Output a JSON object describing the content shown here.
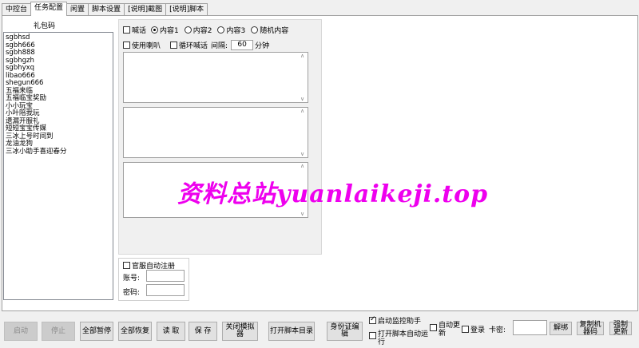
{
  "tabs": [
    {
      "label": "中控台"
    },
    {
      "label": "任务配置"
    },
    {
      "label": "闲置"
    },
    {
      "label": "脚本设置"
    },
    {
      "label": "[说明]截图"
    },
    {
      "label": "[说明]脚本"
    }
  ],
  "gift": {
    "title": "礼包码",
    "codes": [
      "sgbhsd",
      "sgbh666",
      "sgbh888",
      "sgbhgzh",
      "sgbhyxq",
      "libao666",
      "shegun666",
      "五福来临",
      "五福临宝奖励",
      "小小玩宝",
      "小叶陪我玩",
      "遗漏开服礼",
      "短短宝宝传媒",
      "三冰上号时间到",
      "龙油龙狗",
      "三冰小助手喜迎春分"
    ]
  },
  "shout": {
    "checkbox_label": "喊话",
    "radios": [
      "内容1",
      "内容2",
      "内容3",
      "随机内容"
    ],
    "selected": "内容1",
    "speaker_label": "使用喇叭",
    "loop_label": "循环喊话",
    "interval_label": "间隔:",
    "interval_value": "60",
    "unit_label": "分钟"
  },
  "register": {
    "title": "官服自动注册",
    "account_label": "账号:",
    "password_label": "密码:"
  },
  "buttons": {
    "start": "启动",
    "stop": "停止",
    "pause_all": "全部暂停",
    "resume_all": "全部恢复",
    "read": "读 取",
    "save": "保 存",
    "close_emulator": "关闭模拟器",
    "open_dir": "打开脚本目录",
    "id_edit": "身份证编辑",
    "auto_monitor": "启动监控助手",
    "open_script_auto": "打开脚本自动运行",
    "auto_update": "自动更新",
    "login": "登录",
    "card_label": "卡密:",
    "unbind": "解绑",
    "copy_machine": "复制机器码",
    "force_update": "强制更新"
  },
  "watermark": "资料总站yuanlaikeji.top"
}
